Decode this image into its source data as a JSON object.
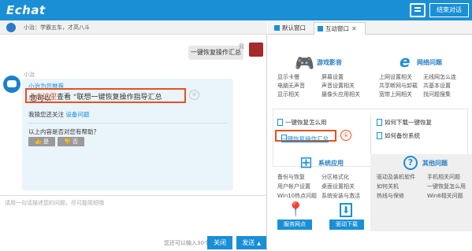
{
  "header": {
    "logo": "Echat",
    "end_button": "结束对话"
  },
  "left": {
    "subtitle": "小治：学霸五车，才高八斗",
    "me_label": "我",
    "me_message": "一键恢复操作汇总",
    "bot_name": "小治",
    "card": {
      "recommend": "小治为您推荐",
      "main_prefix": "您可以",
      "main_link": "点击这里",
      "main_suffix": "查看 “联想一键恢复操作指导汇总",
      "circle_label": "②",
      "follow_prefix": "我猜您还关注",
      "follow_link": "设备问题",
      "question": "以上内容是否对您有帮助？",
      "yes": "👍 是",
      "no": "👎 否"
    },
    "input_placeholder": "请用一句话描述您的问题，尽可能简短哦",
    "limit_text": "您还可以输入30个字",
    "close_button": "关闭",
    "send_button": "发送",
    "send_arrow": "▲"
  },
  "right": {
    "tabs": [
      {
        "label": "默认窗口"
      },
      {
        "label": "互动窗口",
        "close": "✕"
      }
    ],
    "sections": {
      "games": {
        "title": "游戏影音",
        "icon": "🎮",
        "links": [
          "显示卡慢",
          "屏幕设置",
          "电脑无声音",
          "声音设置相关",
          "显示相关",
          "摄像头应用相关"
        ]
      },
      "network": {
        "title": "网络问题",
        "icon": "e",
        "links": [
          "上网设置相关",
          "无线网怎么连",
          "共享断网与卸载",
          "共基本设置",
          "宽带上网相关",
          "找问题搜集"
        ]
      },
      "mid": {
        "links": [
          "一键恢复怎么用",
          "一键恢复操作汇总",
          "如何下载一键恢复",
          "如何备份系统"
        ],
        "circle_label": "①"
      },
      "system": {
        "title": "系统应用",
        "icon": "⊞",
        "links": [
          "备份与恢复",
          "分区格式化",
          "用户帐户设置",
          "桌面设置相关",
          "Win10热点问题",
          "系统安装与激活"
        ]
      },
      "other": {
        "title": "其他问题",
        "icon": "?",
        "links": [
          "驱动及装机软件",
          "手机相关问题",
          "如何关机",
          "一键恢复怎么用",
          "热线与保修",
          "Win8相关问题"
        ]
      },
      "service": {
        "title": "服务网点",
        "icon": "📍"
      },
      "driver": {
        "title": "驱动下载",
        "icon": "⬇"
      }
    }
  },
  "colors": {
    "brand": "#1a8fd6",
    "highlight": "#e8501f"
  }
}
